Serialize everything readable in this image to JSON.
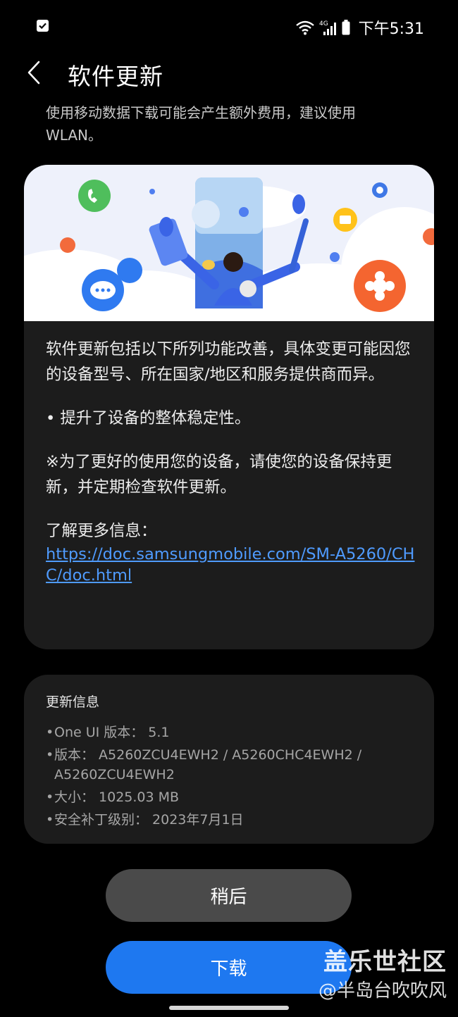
{
  "status_bar": {
    "network": "4G",
    "time": "下午5:31",
    "icons": [
      "notification-check-icon",
      "wifi-icon",
      "signal-icon",
      "battery-icon"
    ]
  },
  "header": {
    "title": "软件更新",
    "back_icon": "chevron-left-icon"
  },
  "notice": "使用移动数据下载可能会产生额外费用，建议使用WLAN。",
  "release_notes": {
    "intro": "软件更新包括以下所列功能改善，具体变更可能因您的设备型号、所在国家/地区和服务提供商而异。",
    "bullet": "• 提升了设备的整体稳定性。",
    "advice": "※为了更好的使用您的设备，请使您的设备保持更新，并定期检查软件更新。",
    "learn_more_label": "了解更多信息：",
    "learn_more_url": "https://doc.samsungmobile.com/SM-A5260/CHC/doc.html"
  },
  "update_info": {
    "title": "更新信息",
    "items": [
      {
        "label": "One UI 版本：",
        "value": "5.1"
      },
      {
        "label": "版本：",
        "value": "A5260ZCU4EWH2 / A5260CHC4EWH2 / A5260ZCU4EWH2"
      },
      {
        "label": "大小：",
        "value": "1025.03 MB"
      },
      {
        "label": "安全补丁级别：",
        "value": "2023年7月1日"
      }
    ]
  },
  "buttons": {
    "later": "稍后",
    "download": "下载"
  },
  "watermark": {
    "site": "盖乐世社区",
    "user": "@半岛台吹吹风"
  },
  "colors": {
    "background": "#000000",
    "card": "#1c1c1c",
    "link": "#4f9bff",
    "download_button": "#1e78f0",
    "later_button": "#4a4a4a"
  }
}
